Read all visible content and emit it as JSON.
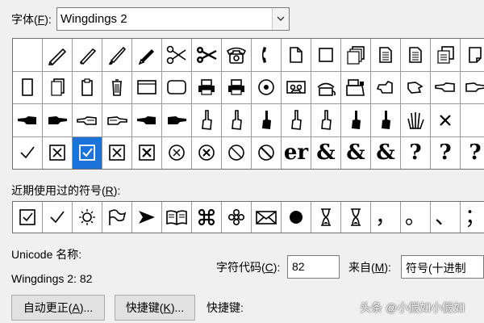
{
  "font_label": "字体(",
  "font_label_key": "F",
  "font_label_end": "):",
  "font_value": "Wingdings 2",
  "symbol_grid": {
    "rows": [
      [
        "blank",
        "pen-nib",
        "pen-nib-2",
        "brush",
        "marker",
        "scissors-open",
        "scissors",
        "telephone",
        "handset",
        "page",
        "square-outline",
        "pages",
        "doc-lines",
        "doc-lines",
        "stack-doc",
        "page-folded"
      ],
      [
        "page-portrait",
        "doc-stack",
        "clipboard",
        "trash",
        "window",
        "rounded-rect",
        "printer",
        "printer",
        "circle-dot",
        "cassette",
        "telephone-cord",
        "cash-register",
        "hand-left",
        "hand-right",
        "hand-point-left",
        "hand-point-right"
      ],
      [
        "hand-point-left-black",
        "hand-point-right-black",
        "hand-point-left-white",
        "hand-point-right-white",
        "hand-point-left-black",
        "hand-point-right-black",
        "hand-up",
        "hand-up",
        "hand-up-black",
        "hand-up",
        "hand-up",
        "hand-up-black",
        "hand-up-black",
        "hand-open",
        "x-mark"
      ],
      [
        "check",
        "boxed-x",
        "boxed-check-selected",
        "boxed-x",
        "boxed-x-bold",
        "circled-x",
        "circled-x-bold",
        "prohibit",
        "prohibit-bold",
        "et-ligature",
        "ampersand",
        "ampersand-2",
        "ampersand-3",
        "interrobang",
        "interrobang-2",
        "interrobang-3"
      ]
    ],
    "glyph_text": {
      "et-ligature": "er",
      "ampersand": "&",
      "ampersand-2": "&",
      "ampersand-3": "&",
      "interrobang": "?",
      "interrobang-2": "?",
      "interrobang-3": "?"
    },
    "selected_index": 50
  },
  "recent_label": "近期使用过的符号(",
  "recent_label_key": "R",
  "recent_label_end": "):",
  "recent_symbols": [
    "boxed-check",
    "check",
    "sun",
    "flag",
    "arrowhead",
    "book",
    "command",
    "flower",
    "envelope",
    "black-circle",
    "hourglass",
    "hourglass",
    "，",
    "。",
    "、",
    "；"
  ],
  "unicode_name_label": "Unicode 名称:",
  "unicode_name_value": "Wingdings 2: 82",
  "char_code_label": "字符代码(",
  "char_code_key": "C",
  "char_code_end": "):",
  "char_code_value": "82",
  "from_label": "来自(",
  "from_key": "M",
  "from_end": "):",
  "from_value": "符号(十进制",
  "autocorrect_button": "自动更正(",
  "autocorrect_key": "A",
  "autocorrect_end": ")...",
  "shortcut_button": "快捷键(",
  "shortcut_key": "K",
  "shortcut_end": ")...",
  "shortcut_label": "快捷键:",
  "watermark": "头条 @小假如小假如",
  "colors": {
    "selection": "#1a73d9",
    "window_bg": "#f0f0f0"
  }
}
